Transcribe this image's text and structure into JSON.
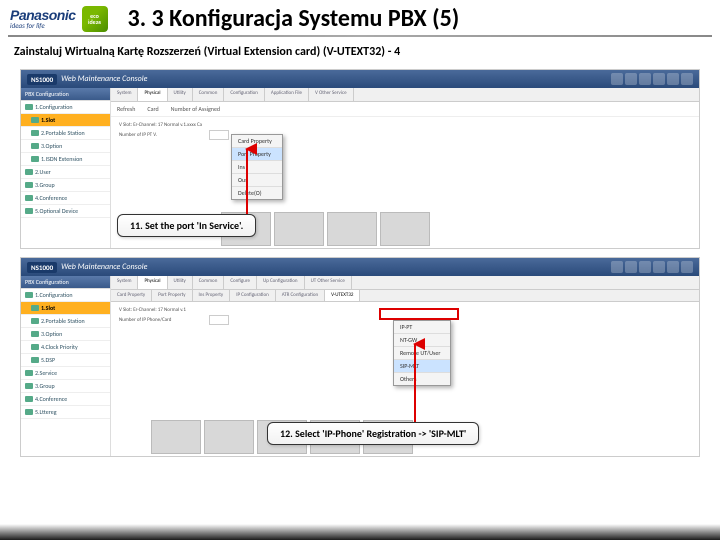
{
  "header": {
    "brand": "Panasonic",
    "tagline": "ideas for life",
    "eco_label1": "eco",
    "eco_label2": "ideas",
    "title": "3. 3 Konfiguracja Systemu PBX (5)"
  },
  "subtitle": "Zainstaluj Wirtualną Kartę Rozszerzeń (Virtual Extension card) (V-UTEXT32) - 4",
  "ss_common": {
    "ns": "NS1000",
    "wmc": "Web Maintenance Console"
  },
  "ss1": {
    "side_header": "PBX Configuration",
    "side_items": [
      "1.Configuration",
      "1.Slot",
      "2.Portable Station",
      "3.Option",
      "1.ISDN Extension",
      "2.User",
      "3.Group",
      "4.Conference",
      "5.Optional Device"
    ],
    "side_selected_index": 1,
    "tabs": [
      "System",
      "Physical",
      "Utility",
      "Common",
      "Configuration",
      "Application File",
      "V Other Service"
    ],
    "active_tab_index": 1,
    "sub_labels": [
      "Refresh",
      "Card",
      "Number of Assigned"
    ],
    "row1_label": "V Slot: Er-Channel: 17 Normal v.1.xxxx Ca",
    "row2_label": "Number of IP PT V.",
    "menu_items": [
      "Card Property",
      "Port Property",
      "Ins",
      "Ous",
      "Delete(O)"
    ],
    "menu_selected_index": 1,
    "callout": "11. Set the port 'In Service'."
  },
  "ss2": {
    "side_header": "PBX Configuration",
    "side_items": [
      "1.Configuration",
      "1.Slot",
      "2.Portable Station",
      "3.Option",
      "4.Clock Priority",
      "5.DSP",
      "2.Service",
      "3.Group",
      "4.Conference",
      "5.Lttereg"
    ],
    "side_selected_index": 1,
    "tabs": [
      "System",
      "Physical",
      "Utility",
      "Common",
      "Configure",
      "Up Configuration",
      "UT Other Service"
    ],
    "active_tab_index": 1,
    "tabs2": [
      "Card Property",
      "Port Property",
      "Ins Property",
      "IP Configuration",
      "ATR Configuration",
      "V-UTEXT32"
    ],
    "row1_label": "V Slot: Er-Channel: 17 Normal v.1",
    "row2_label": "Number of IP Phone/Card",
    "menu_items": [
      "IP-PT",
      "NT-GW",
      "Remote UT/User",
      "SIP-MLT",
      "Others"
    ],
    "menu_selected_index": 3,
    "callout": "12. Select 'IP-Phone' Registration -> 'SIP-MLT'"
  }
}
